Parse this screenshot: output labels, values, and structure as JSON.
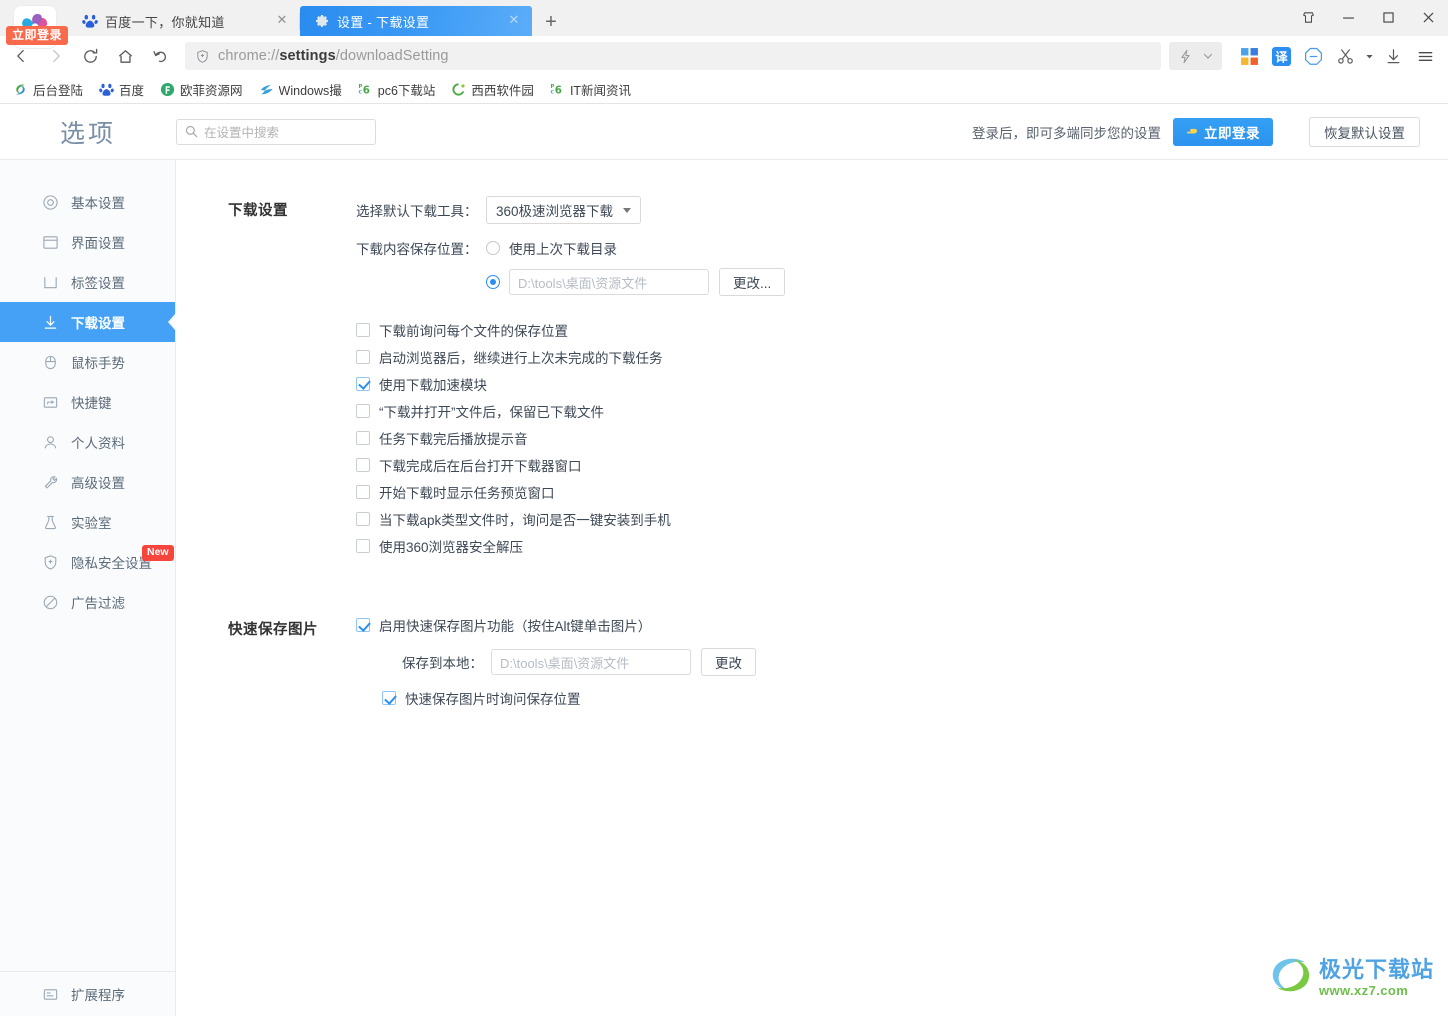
{
  "window": {
    "controls": [
      {
        "name": "skin-button",
        "glyph": "skin"
      },
      {
        "name": "minimize-button",
        "glyph": "minimize"
      },
      {
        "name": "maximize-button",
        "glyph": "maximize"
      },
      {
        "name": "close-button",
        "glyph": "close"
      }
    ]
  },
  "browser": {
    "login_badge": "立即登录",
    "tabs": [
      {
        "title": "百度一下，你就知道",
        "favicon": "baidu-icon",
        "active": false,
        "close": "✕"
      },
      {
        "title": "设置 - 下载设置",
        "favicon": "gear-icon",
        "active": true,
        "close": "✕"
      }
    ],
    "new_tab_label": "+",
    "nav": {
      "back": "‹",
      "forward": "›",
      "reload": "⟳",
      "home": "⌂",
      "undo": "↺"
    },
    "omnibox": {
      "url_prefix": "chrome://",
      "url_bold": "settings",
      "url_suffix": "/downloadSetting",
      "shield_icon": "shield-plus-icon"
    },
    "toolbar_icons": [
      {
        "name": "lightning-icon",
        "label": "⚡"
      },
      {
        "name": "chevron-down-icon",
        "label": "⌄"
      },
      {
        "name": "apps-grid-icon",
        "label": ""
      },
      {
        "name": "translate-icon",
        "label": "译"
      },
      {
        "name": "adblock-icon",
        "label": ""
      },
      {
        "name": "screenshot-scissors-icon",
        "label": "✂"
      },
      {
        "name": "scissors-dropdown-icon",
        "label": "▾"
      },
      {
        "name": "downloads-icon",
        "label": "↓"
      },
      {
        "name": "menu-icon",
        "label": "≡"
      }
    ],
    "bookmarks": [
      {
        "label": "后台登陆",
        "icon": "swirl-icon",
        "color": "#4aa845"
      },
      {
        "label": "百度",
        "icon": "baidu-icon",
        "color": "#2b5fd9"
      },
      {
        "label": "欧菲资源网",
        "icon": "circle-f-icon",
        "color": "#2fa86b"
      },
      {
        "label": "Windows撮",
        "icon": "windows-icon",
        "color": "#3aa0d8"
      },
      {
        "label": "pc6下载站",
        "icon": "pc6-icon",
        "color": "#4aa845"
      },
      {
        "label": "西西软件园",
        "icon": "xixi-icon",
        "color": "#4aa845"
      },
      {
        "label": "IT新闻资讯",
        "icon": "pc6-icon",
        "color": "#4aa845"
      }
    ]
  },
  "settings": {
    "page_title": "选项",
    "search": {
      "placeholder": "在设置中搜索",
      "icon": "search-icon"
    },
    "sync_hint": "登录后，即可多端同步您的设置",
    "login_button": "立即登录",
    "restore_button": "恢复默认设置",
    "sidebar": {
      "items": [
        {
          "label": "基本设置",
          "icon": "target-icon",
          "active": false,
          "badge": null
        },
        {
          "label": "界面设置",
          "icon": "window-icon",
          "active": false,
          "badge": null
        },
        {
          "label": "标签设置",
          "icon": "tab-icon",
          "active": false,
          "badge": null
        },
        {
          "label": "下载设置",
          "icon": "download-icon",
          "active": true,
          "badge": null
        },
        {
          "label": "鼠标手势",
          "icon": "mouse-icon",
          "active": false,
          "badge": null
        },
        {
          "label": "快捷键",
          "icon": "keyboard-icon",
          "active": false,
          "badge": null
        },
        {
          "label": "个人资料",
          "icon": "user-icon",
          "active": false,
          "badge": null
        },
        {
          "label": "高级设置",
          "icon": "wrench-icon",
          "active": false,
          "badge": null
        },
        {
          "label": "实验室",
          "icon": "flask-icon",
          "active": false,
          "badge": null
        },
        {
          "label": "隐私安全设置",
          "icon": "shield-plus-icon",
          "active": false,
          "badge": "New"
        },
        {
          "label": "广告过滤",
          "icon": "ban-icon",
          "active": false,
          "badge": null
        }
      ],
      "footer": {
        "label": "扩展程序",
        "icon": "extension-icon"
      }
    },
    "download_section": {
      "title": "下载设置",
      "tool_label": "选择默认下载工具：",
      "tool_value": "360极速浏览器下载",
      "location_label": "下载内容保存位置：",
      "radio_last_dir": {
        "label": "使用上次下载目录",
        "selected": false
      },
      "radio_custom": {
        "selected": true,
        "path": "D:\\tools\\桌面\\资源文件",
        "change_button": "更改..."
      },
      "checkboxes": [
        {
          "label": "下载前询问每个文件的保存位置",
          "checked": false
        },
        {
          "label": "启动浏览器后，继续进行上次未完成的下载任务",
          "checked": false
        },
        {
          "label": "使用下载加速模块",
          "checked": true
        },
        {
          "label": "“下载并打开”文件后，保留已下载文件",
          "checked": false
        },
        {
          "label": "任务下载完后播放提示音",
          "checked": false
        },
        {
          "label": "下载完成后在后台打开下载器窗口",
          "checked": false
        },
        {
          "label": "开始下载时显示任务预览窗口",
          "checked": false
        },
        {
          "label": "当下载apk类型文件时，询问是否一键安装到手机",
          "checked": false
        },
        {
          "label": "使用360浏览器安全解压",
          "checked": false
        }
      ]
    },
    "quicksave_section": {
      "title": "快速保存图片",
      "enable": {
        "label": "启用快速保存图片功能（按住Alt键单击图片）",
        "checked": true
      },
      "save_to_label": "保存到本地：",
      "save_to_path": "D:\\tools\\桌面\\资源文件",
      "change_button": "更改",
      "ask_location": {
        "label": "快速保存图片时询问保存位置",
        "checked": true
      }
    }
  },
  "watermark": {
    "main": "极光下载站",
    "sub": "www.xz7.com"
  },
  "colors": {
    "accent_blue": "#45a1f5",
    "tab_blue": "#2a8cf0",
    "badge_red": "#f5453d",
    "login_orange": "#f96a4d",
    "sidebar_bg": "#fafbfc"
  }
}
